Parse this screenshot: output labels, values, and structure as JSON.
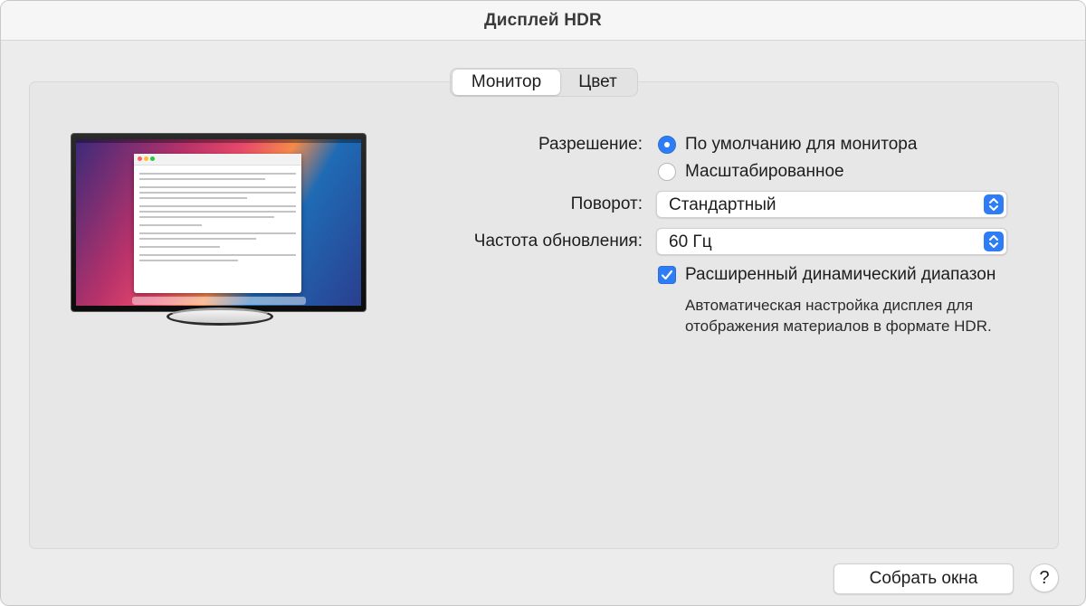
{
  "window": {
    "title": "Дисплей HDR"
  },
  "tabs": [
    {
      "label": "Монитор",
      "active": true
    },
    {
      "label": "Цвет",
      "active": false
    }
  ],
  "settings": {
    "resolution": {
      "label": "Разрешение:",
      "options": [
        {
          "label": "По умолчанию для монитора",
          "selected": true
        },
        {
          "label": "Масштабированное",
          "selected": false
        }
      ]
    },
    "rotation": {
      "label": "Поворот:",
      "value": "Стандартный"
    },
    "refresh_rate": {
      "label": "Частота обновления:",
      "value": "60 Гц"
    },
    "hdr": {
      "label": "Расширенный динамический диапазон",
      "checked": true,
      "description_line1": "Автоматическая настройка дисплея для",
      "description_line2": "отображения материалов в формате HDR."
    }
  },
  "footer": {
    "gather_windows_label": "Собрать окна",
    "help_label": "?"
  },
  "colors": {
    "accent": "#2e7cf6",
    "window_bg": "#ececec",
    "panel_bg": "#e7e7e7"
  },
  "icons": {
    "stepper": "chevron-up-down-icon",
    "checkbox": "checkmark-icon"
  }
}
